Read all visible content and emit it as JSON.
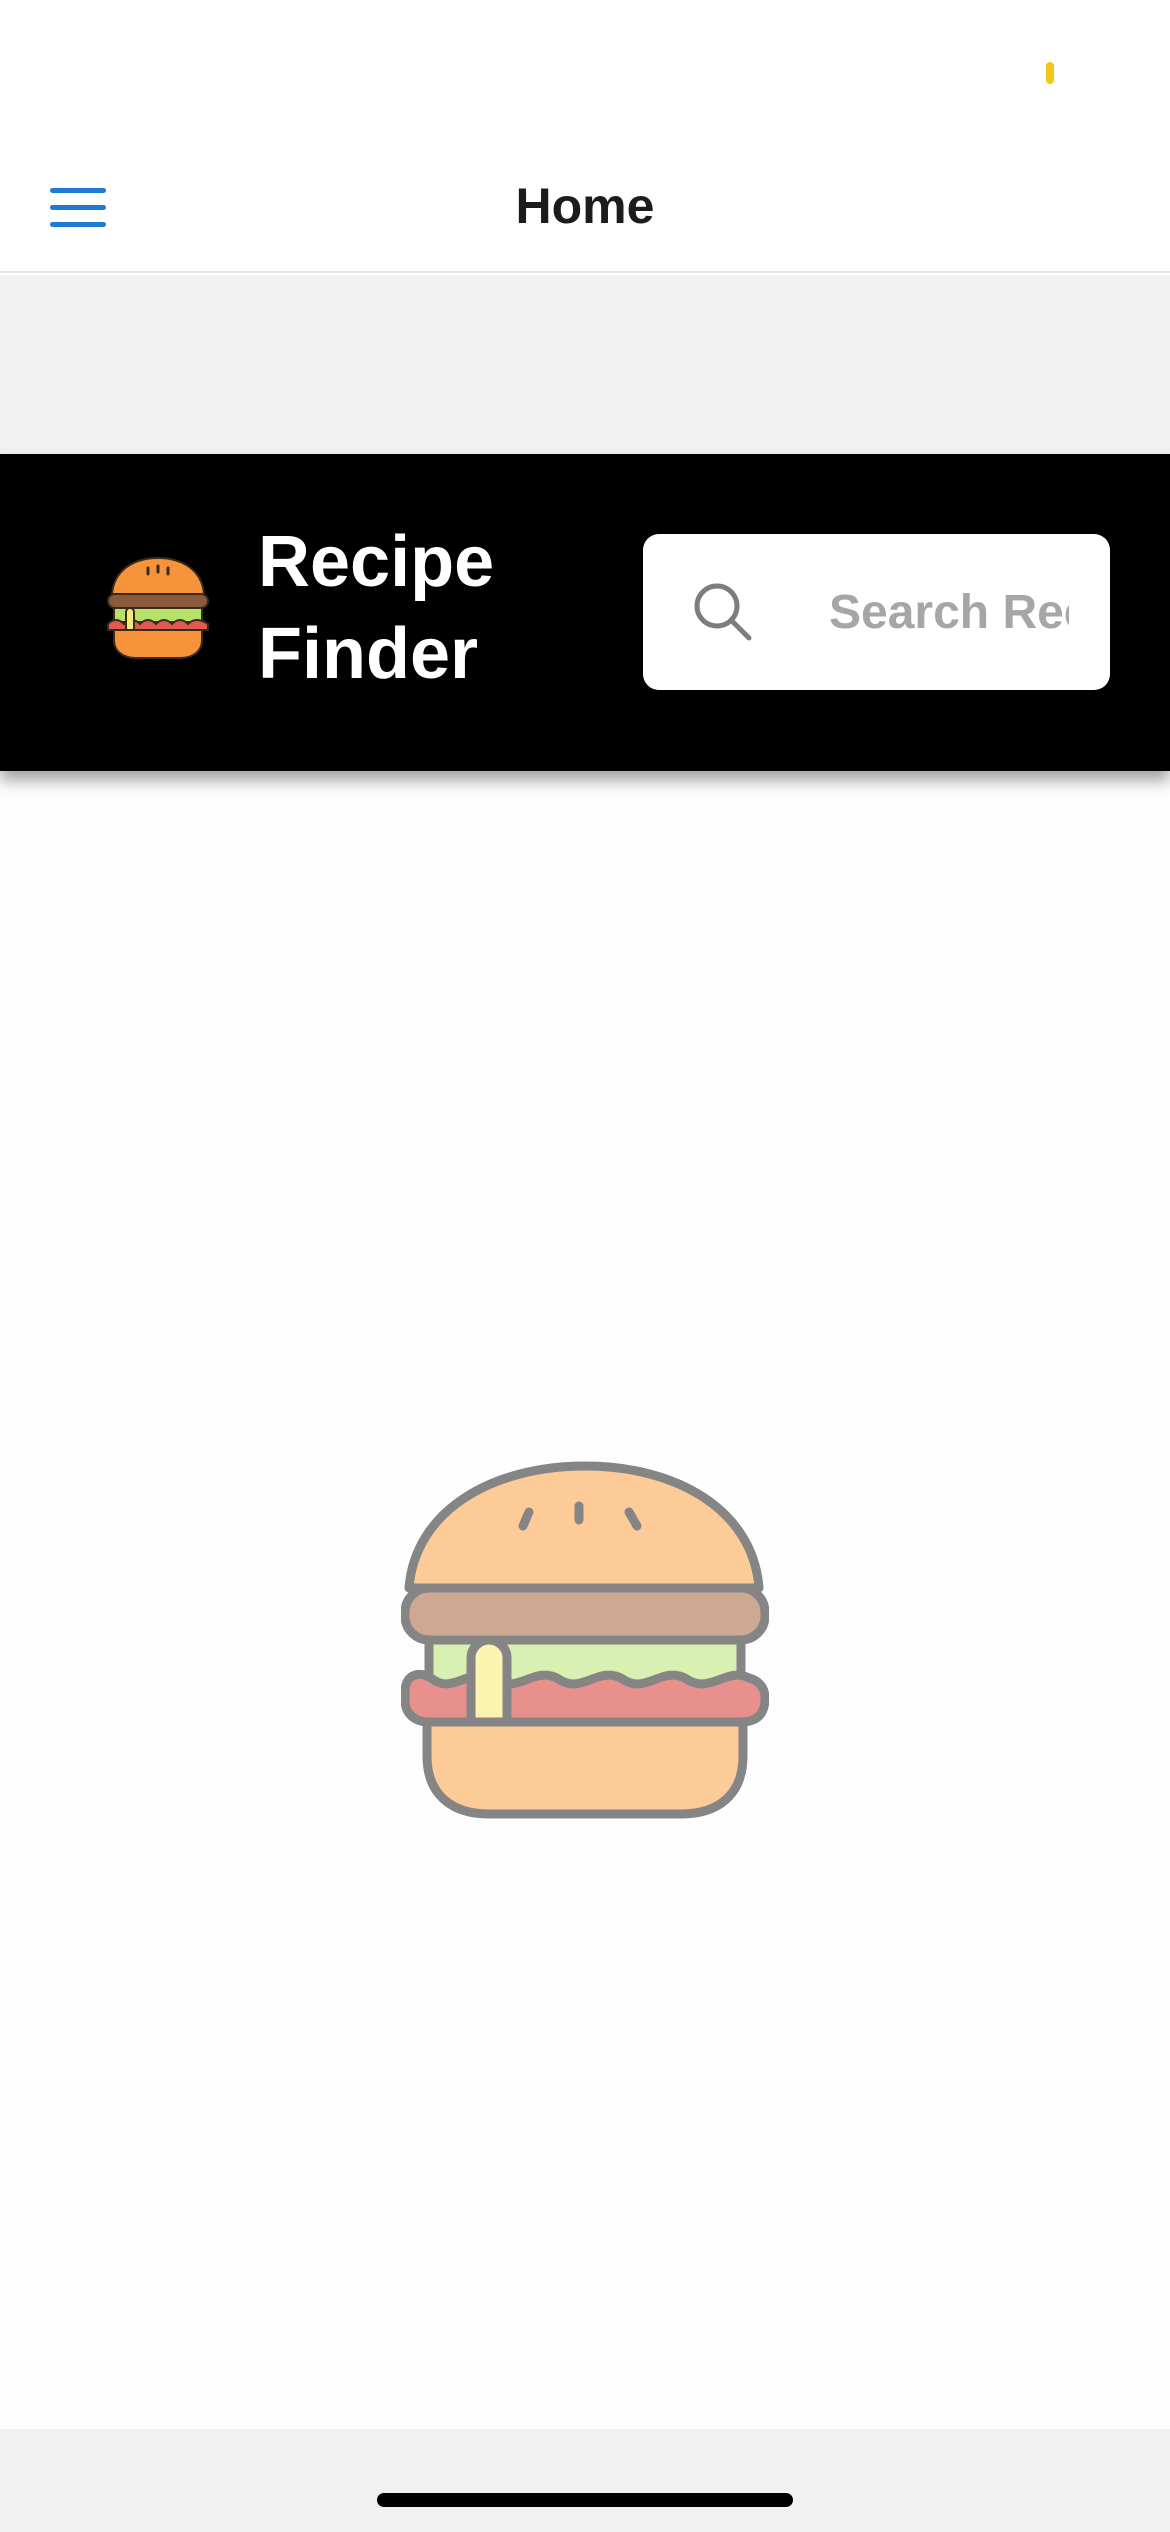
{
  "nav": {
    "title": "Home",
    "menu_icon": "hamburger-menu-icon",
    "accent_color": "#1f7ad6"
  },
  "status_bar": {
    "indicator_color": "#f5c518"
  },
  "header": {
    "background": "#000000",
    "logo_icon": "burger-icon",
    "title_line1": "Recipe",
    "title_line2": "Finder",
    "search": {
      "placeholder": "Search Recipes",
      "value": "",
      "icon": "search-icon"
    }
  },
  "main": {
    "illustration_icon": "burger-icon"
  }
}
